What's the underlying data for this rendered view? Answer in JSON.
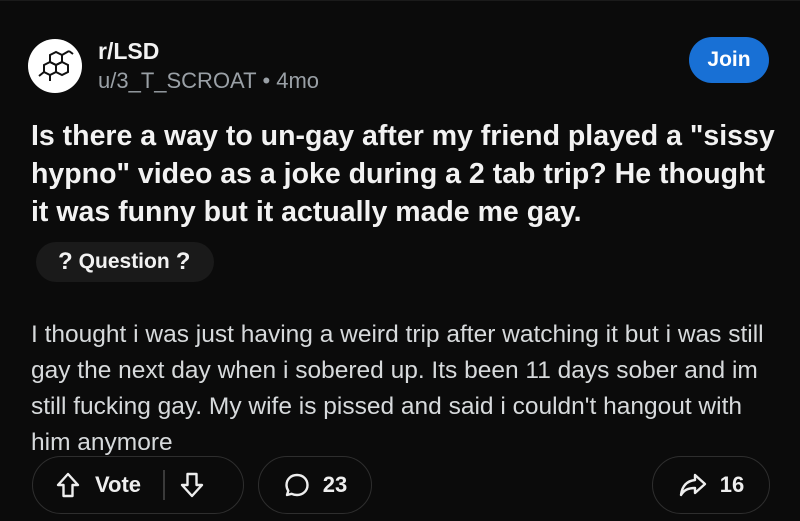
{
  "subreddit": {
    "name": "r/LSD",
    "icon": "molecule-icon"
  },
  "post": {
    "author": "u/3_T_SCROAT",
    "separator": "•",
    "age": "4mo",
    "title": "Is there a way to un-gay after my friend played a \"sissy hypno\" video as a joke during a 2 tab trip? He thought it was funny but it actually made me gay.",
    "flair": {
      "prefix": "?",
      "label": "Question",
      "suffix": "?"
    },
    "body": "I thought i was just having a weird trip after   watching it but i was still gay the next day when i sobered up. Its been 11 days sober and im still fucking gay. My wife is pissed and said i couldn't hangout with him anymore"
  },
  "actions": {
    "join_label": "Join",
    "vote_label": "Vote",
    "comment_count": "23",
    "share_count": "16"
  },
  "colors": {
    "accent": "#1870d5",
    "background": "#0b0b0b",
    "text": "#f2f2f2",
    "muted": "#9aa0a6"
  }
}
